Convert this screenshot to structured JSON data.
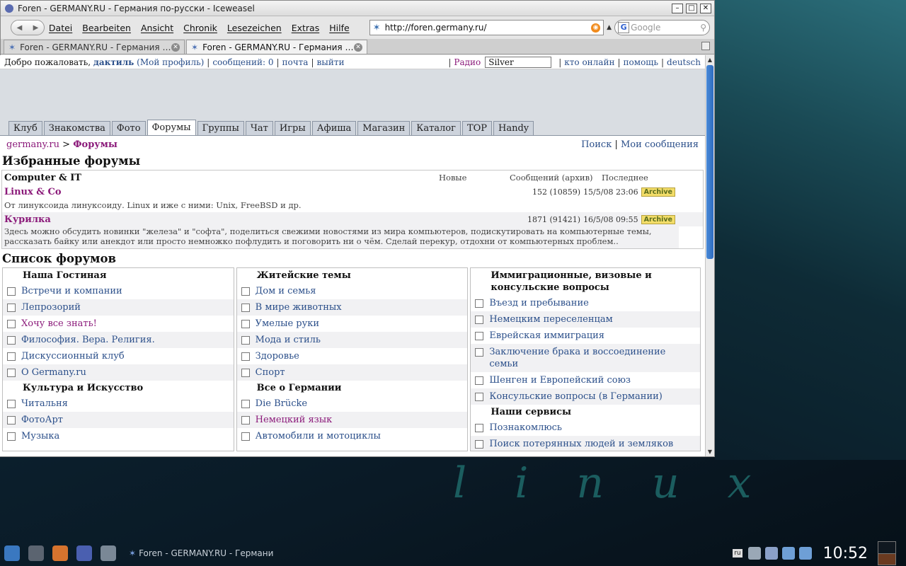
{
  "window": {
    "title": "Foren - GERMANY.RU - Германия по-русски - Iceweasel"
  },
  "menubar": [
    "Datei",
    "Bearbeiten",
    "Ansicht",
    "Chronik",
    "Lesezeichen",
    "Extras",
    "Hilfe"
  ],
  "urlbar": {
    "url": "http://foren.germany.ru/"
  },
  "search": {
    "placeholder": "Google"
  },
  "tabs": [
    {
      "label": "Foren - GERMANY.RU - Германия п..."
    },
    {
      "label": "Foren - GERMANY.RU - Германия п..."
    }
  ],
  "topinfo": {
    "welcome": "Добро пожаловать,",
    "user": "дактиль",
    "profile": "(Мой профиль)",
    "messages": "сообщений: 0",
    "mail": "почта",
    "logout": "выйти",
    "radio": "Радио",
    "skin": "Silver",
    "online": "кто онлайн",
    "help": "помощь",
    "lang": "deutsch"
  },
  "navtabs": [
    "Клуб",
    "Знакомства",
    "Фото",
    "Форумы",
    "Группы",
    "Чат",
    "Игры",
    "Афиша",
    "Магазин",
    "Каталог",
    "TOP",
    "Handy"
  ],
  "crumb": {
    "home": "germany.ru",
    "current": "Форумы",
    "search": "Поиск",
    "mine": "Мои сообщения"
  },
  "favorites": {
    "heading": "Избранные форумы",
    "category": "Computer & IT",
    "col_new": "Новые",
    "col_posts": "Сообщений (архив)",
    "col_last": "Последнее",
    "forums": [
      {
        "name": "Linux & Co",
        "stats": "152 (10859)",
        "date": "15/5/08 23:06",
        "badge": "Archive",
        "desc": "От линуксоида линуксоиду. Linux и иже с ними: Unix, FreeBSD и др."
      },
      {
        "name": "Курилка",
        "stats": "1871 (91421)",
        "date": "16/5/08 09:55",
        "badge": "Archive",
        "desc": "Здесь можно обсудить новинки \"железа\" и \"софта\", поделиться свежими новостями из мира компьютеров, подискутировать на компьютерные темы, рассказать байку или анекдот или просто немножко пофлудить и поговорить ни о чём. Сделай перекур, отдохни от компьютерных проблем.."
      }
    ]
  },
  "forumlist": {
    "heading": "Список форумов",
    "col1": {
      "g1": "Наша Гостиная",
      "g1_items": [
        "Встречи и компании",
        "Лепрозорий",
        "Хочу все знать!",
        "Философия. Вера. Религия.",
        "Дискуссионный клуб",
        "О Germany.ru"
      ],
      "g2": "Культура и Искусство",
      "g2_items": [
        "Читальня",
        "ФотоАрт",
        "Музыка"
      ]
    },
    "col2": {
      "g1": "Житейские темы",
      "g1_items": [
        "Дом и семья",
        "В мире животных",
        "Умелые руки",
        "Мода и стиль",
        "Здоровье",
        "Спорт"
      ],
      "g2": "Все о Германии",
      "g2_items": [
        "Die Brücke",
        "Немецкий язык",
        "Автомобили и мотоциклы"
      ]
    },
    "col3": {
      "g1": "Иммиграционные, визовые и консульские вопросы",
      "g1_items": [
        "Въезд и пребывание",
        "Немецким переселенцам",
        "Еврейская иммиграция",
        "Заключение брака и воссоединение семьи",
        "Шенген и Европейский союз",
        "Консульские вопросы (в Германии)"
      ],
      "g2": "Наши сервисы",
      "g2_items": [
        "Познакомлюсь",
        "Поиск потерянных людей и земляков"
      ]
    }
  },
  "desktop": {
    "logo": "linux"
  },
  "taskbar": {
    "task": "Foren - GERMANY.RU - Германи",
    "lang": "ru",
    "clock": "10:52"
  }
}
